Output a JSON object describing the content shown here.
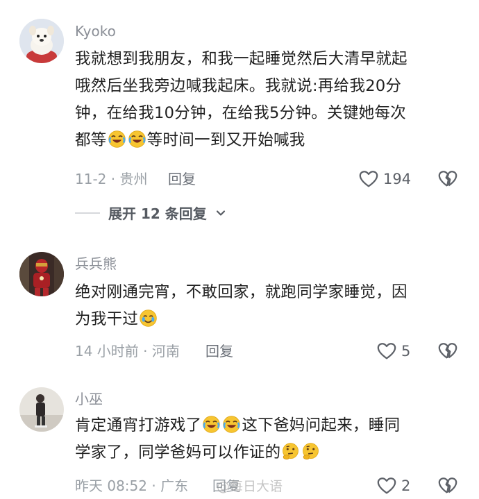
{
  "comments": [
    {
      "username": "Kyoko",
      "lines": [
        "我就想到我朋友，和我一起睡觉然后大清早就起",
        "哦然后坐我旁边喊我起床。我就说:再给我20分",
        "钟，在给我10分钟，在给我5分钟。关键她每次",
        "都等",
        "等时间一到又开始喊我"
      ],
      "meta": "11-2 · 贵州",
      "reply_label": "回复",
      "likes": "194",
      "expand_label": "展开 12 条回复"
    },
    {
      "username": "兵兵熊",
      "lines": [
        "绝对刚通完宵，不敢回家，就跑同学家睡觉，因",
        "为我干过"
      ],
      "meta": "14 小时前 · 河南",
      "reply_label": "回复",
      "likes": "5"
    },
    {
      "username": "小巫",
      "lines": [
        "肯定通宵打游戏了",
        "这下爸妈问起来，睡同",
        "学家了，同学爸妈可以作证的"
      ],
      "meta": "昨天 08:52 · 广东",
      "reply_label": "回复",
      "likes": "2"
    }
  ],
  "watermark": "@每日大语",
  "icons": {
    "like": "heart-outline-icon",
    "dislike": "broken-heart-icon",
    "chevron": "chevron-down-icon",
    "emoji_laugh_cry": "rolling-on-floor-laughing-emoji",
    "emoji_teary": "teary-smile-emoji",
    "emoji_thinking": "thinking-face-emoji"
  },
  "colors": {
    "meta_gray": "#9aa0a6",
    "text": "#1f1f1f",
    "emoji_yellow": "#f7c531"
  }
}
